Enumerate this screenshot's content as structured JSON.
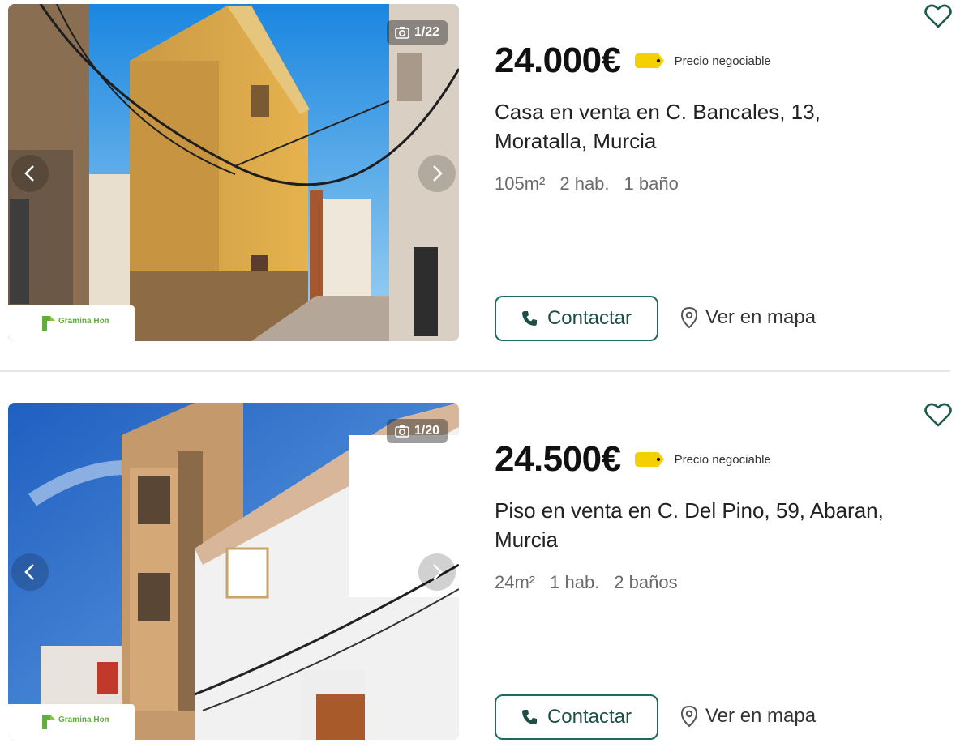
{
  "listings": [
    {
      "price": "24.000€",
      "negotiable": "Precio negociable",
      "title": "Casa en venta en C. Bancales, 13, Moratalla, Murcia",
      "area": "105m²",
      "rooms": "2 hab.",
      "baths": "1 baño",
      "photo_counter": "1/22",
      "agency_logo": "Gramina Homes",
      "contact_label": "Contactar",
      "map_label": "Ver en mapa"
    },
    {
      "price": "24.500€",
      "negotiable": "Precio negociable",
      "title": "Piso en venta en C. Del Pino, 59, Abaran, Murcia",
      "area": "24m²",
      "rooms": "1 hab.",
      "baths": "2 baños",
      "photo_counter": "1/20",
      "agency_logo": "Gramina Homes",
      "contact_label": "Contactar",
      "map_label": "Ver en mapa"
    }
  ],
  "colors": {
    "accent": "#1d6b5f",
    "tag": "#f5d000"
  },
  "icons": [
    "heart-icon",
    "phone-icon",
    "map-pin-icon",
    "camera-icon",
    "chevron-left-icon",
    "chevron-right-icon",
    "price-tag-icon"
  ]
}
